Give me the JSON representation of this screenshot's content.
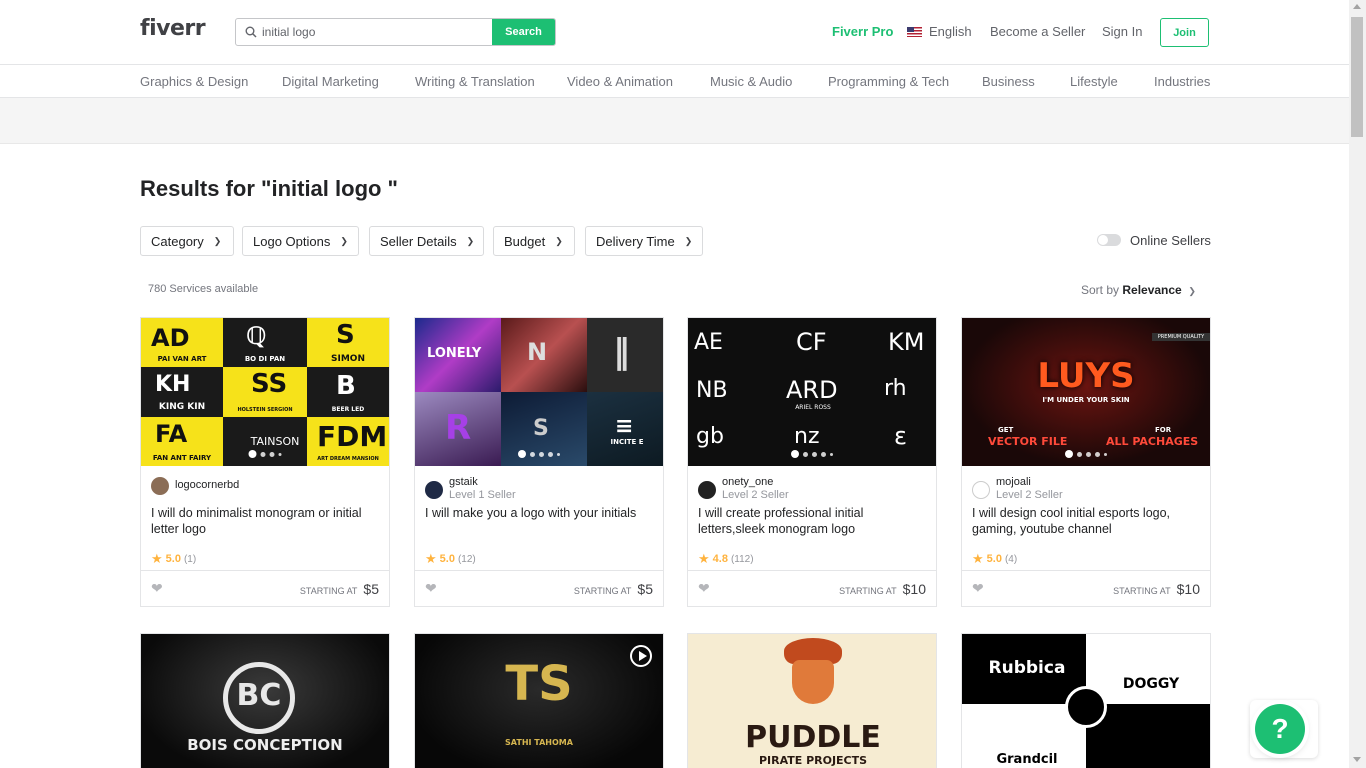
{
  "header": {
    "logo": "fiverr",
    "search_value": "initial logo",
    "search_button": "Search",
    "fiverr_pro": "Fiverr Pro",
    "language": "English",
    "become_seller": "Become a Seller",
    "sign_in": "Sign In",
    "join": "Join"
  },
  "categories": [
    "Graphics & Design",
    "Digital Marketing",
    "Writing & Translation",
    "Video & Animation",
    "Music & Audio",
    "Programming & Tech",
    "Business",
    "Lifestyle",
    "Industries"
  ],
  "results_title": "Results for \"initial logo \"",
  "filters": [
    "Category",
    "Logo Options",
    "Seller Details",
    "Budget",
    "Delivery Time"
  ],
  "online_sellers": "Online Sellers",
  "services_count": "780 Services available",
  "sort": {
    "label": "Sort by",
    "value": "Relevance"
  },
  "gigs": [
    {
      "seller": "logocornerbd",
      "level": "",
      "title": "I will do minimalist monogram or initial letter logo",
      "rating": "5.0",
      "reviews": "(1)",
      "starting_label": "STARTING AT",
      "price": "$5",
      "thumb_texts": [
        "PAI VAN ART",
        "BO DI PAN",
        "SIMON",
        "KING KIN",
        "HOLSTEIN SERGION",
        "BEER LED",
        "FAN ANT FAIRY",
        "TAINSON",
        "ART DREAM MANSION"
      ]
    },
    {
      "seller": "gstaik",
      "level": "Level 1 Seller",
      "title": "I will make you a logo with your initials",
      "rating": "5.0",
      "reviews": "(12)",
      "starting_label": "STARTING AT",
      "price": "$5",
      "thumb_texts": [
        "LONELY",
        "INCITE E"
      ]
    },
    {
      "seller": "onety_one",
      "level": "Level 2 Seller",
      "title": "I will create professional initial letters,sleek monogram logo",
      "rating": "4.8",
      "reviews": "(112)",
      "starting_label": "STARTING AT",
      "price": "$10",
      "thumb_texts": [
        "AE",
        "CF",
        "KM",
        "ARD",
        "ARIEL ROSS",
        "rh",
        "gb",
        "nz"
      ]
    },
    {
      "seller": "mojoali",
      "level": "Level 2 Seller",
      "title": "I will design cool initial esports logo, gaming, youtube channel",
      "rating": "5.0",
      "reviews": "(4)",
      "starting_label": "STARTING AT",
      "price": "$10",
      "thumb_texts": [
        "PREMIUM QUALITY",
        "LUYS",
        "I'M UNDER YOUR SKIN",
        "GET",
        "FOR",
        "VECTOR FILE",
        "ALL PACHAGES"
      ]
    }
  ],
  "second_row": [
    {
      "thumb_texts": [
        "BC",
        "BOIS CONCEPTION"
      ]
    },
    {
      "thumb_texts": [
        "TS",
        "SATHI TAHOMA"
      ]
    },
    {
      "thumb_texts": [
        "PUDDLE",
        "PIRATE PROJECTS"
      ]
    },
    {
      "thumb_texts": [
        "Rubbica",
        "DOGGY",
        "Grandcil"
      ]
    }
  ],
  "help": "?",
  "colors": {
    "brand_green": "#1dbf73",
    "star": "#ffb33e"
  }
}
